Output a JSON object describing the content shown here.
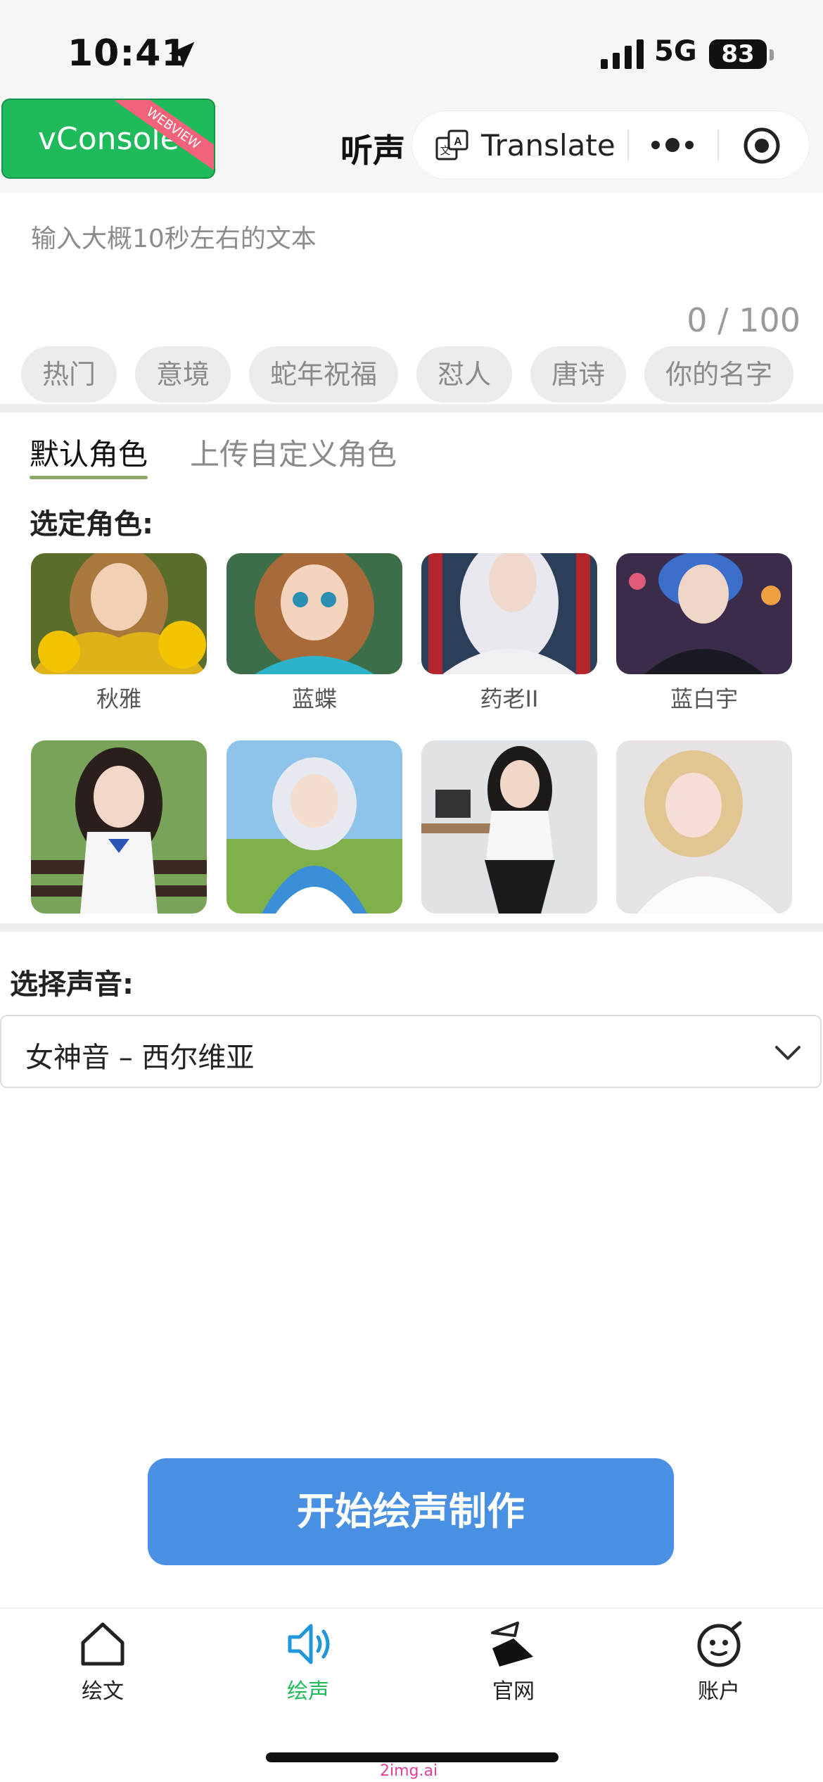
{
  "status_bar": {
    "time": "10:41",
    "network": "5G",
    "battery": "83"
  },
  "nav": {
    "debug_button": "vConsole",
    "debug_badge": "WEBVIEW",
    "title": "听声",
    "translate_label": "Translate"
  },
  "text_input": {
    "placeholder": "输入大概10秒左右的文本",
    "value": "",
    "counter": "0 / 100"
  },
  "tags": [
    "热门",
    "意境",
    "蛇年祝福",
    "怼人",
    "唐诗",
    "你的名字"
  ],
  "role_tabs": [
    "默认角色",
    "上传自定义角色"
  ],
  "selected_role_label": "选定角色:",
  "characters_row1": [
    "秋雅",
    "蓝蝶",
    "药老II",
    "蓝白宇"
  ],
  "voice_label": "选择声音:",
  "voice_value": "女神音 – 西尔维亚",
  "start_button": "开始绘声制作",
  "tabbar": [
    "绘文",
    "绘声",
    "官网",
    "账户"
  ],
  "active_tab": "绘声",
  "watermark": "2img.ai",
  "colors": {
    "brand_green": "#1fba59",
    "primary_blue": "#4a90e2",
    "tab_underline": "#8fa86a"
  }
}
